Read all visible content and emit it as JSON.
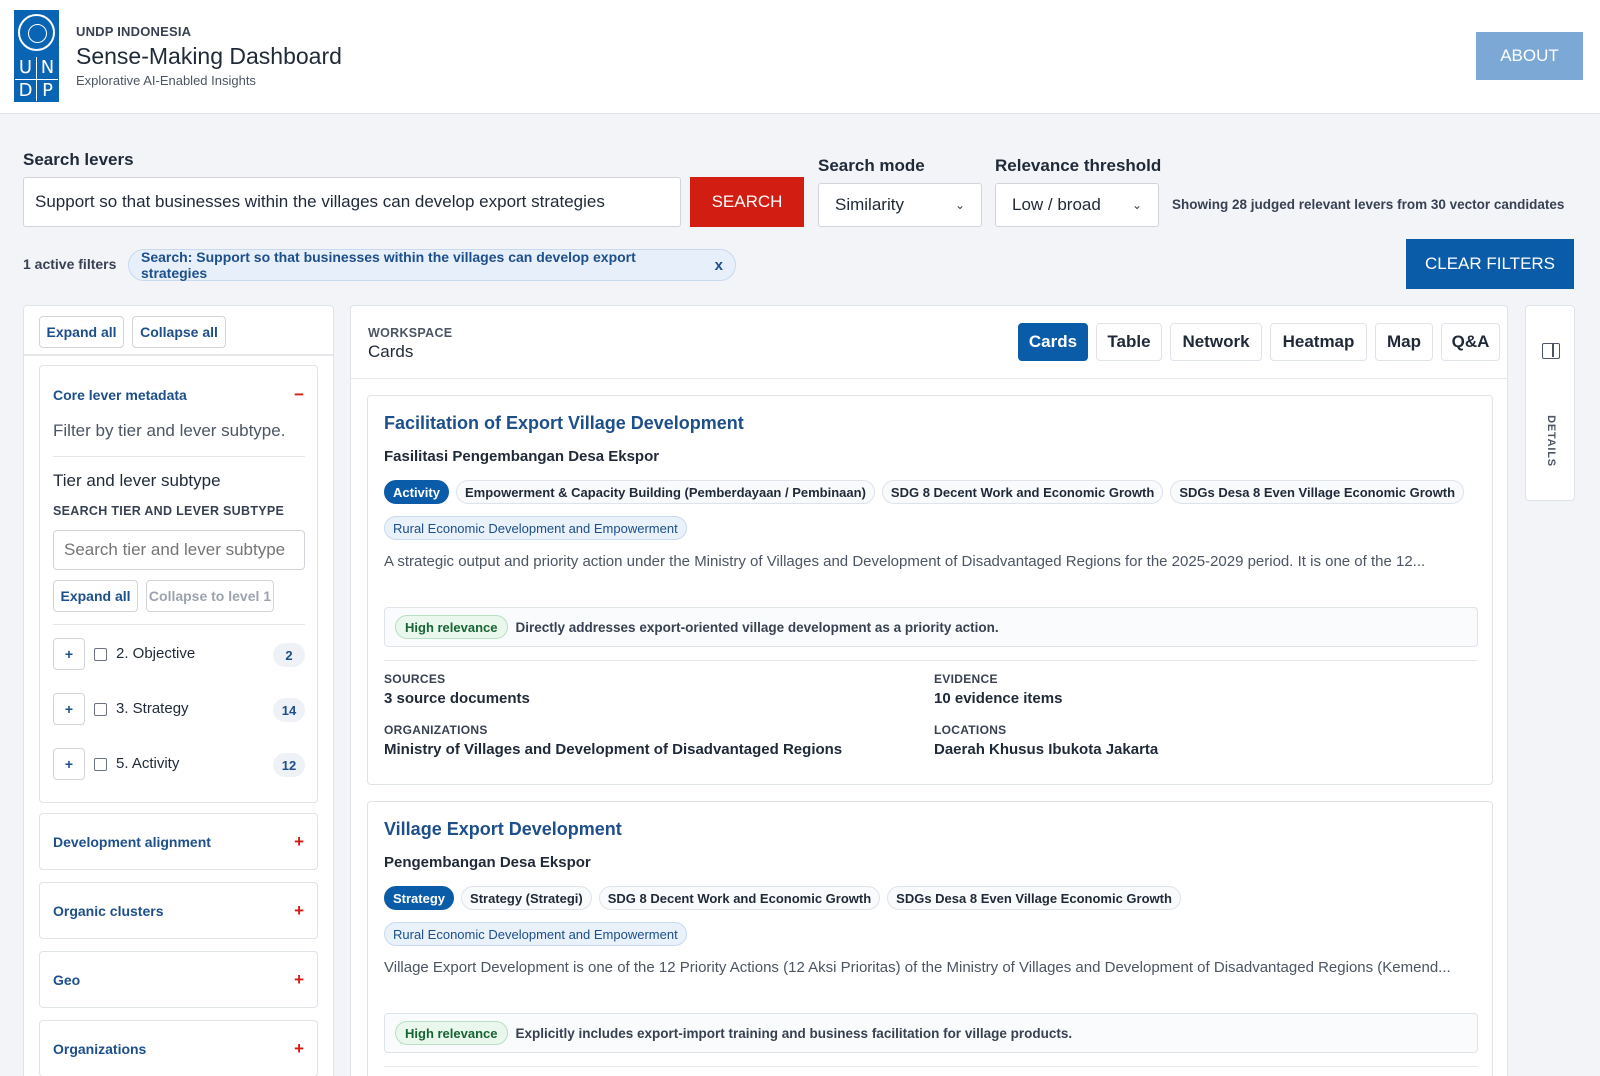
{
  "header": {
    "org": "UNDP INDONESIA",
    "title": "Sense-Making Dashboard",
    "subtitle": "Explorative AI-Enabled Insights",
    "logo_letters": [
      "U",
      "N",
      "D",
      "P"
    ],
    "about_label": "ABOUT"
  },
  "search": {
    "label": "Search levers",
    "value": "Support so that businesses within the villages can develop export strategies",
    "button_label": "SEARCH",
    "mode_label": "Search mode",
    "mode_value": "Similarity",
    "threshold_label": "Relevance threshold",
    "threshold_value": "Low / broad",
    "status": "Showing 28 judged relevant levers from 30 vector candidates"
  },
  "filters": {
    "count_text": "1 active filters",
    "chips": [
      {
        "label": "Search: Support so that businesses within the villages can develop export strategies",
        "close": "x"
      }
    ],
    "clear_label": "CLEAR FILTERS"
  },
  "sidebar": {
    "expand_all": "Expand all",
    "collapse_all": "Collapse all",
    "core": {
      "title": "Core lever metadata",
      "sign": "−",
      "description": "Filter by tier and lever subtype.",
      "subtitle": "Tier and lever subtype",
      "search_caption": "SEARCH TIER AND LEVER SUBTYPE",
      "search_placeholder": "Search tier and lever subtype",
      "expand_all": "Expand all",
      "collapse_level": "Collapse to level 1",
      "items": [
        {
          "label": "2. Objective",
          "count": "2"
        },
        {
          "label": "3. Strategy",
          "count": "14"
        },
        {
          "label": "5. Activity",
          "count": "12"
        }
      ]
    },
    "sections": [
      {
        "title": "Development alignment",
        "sign": "+"
      },
      {
        "title": "Organic clusters",
        "sign": "+"
      },
      {
        "title": "Geo",
        "sign": "+"
      },
      {
        "title": "Organizations",
        "sign": "+"
      }
    ]
  },
  "workspace": {
    "caption": "WORKSPACE",
    "title": "Cards",
    "tabs": [
      "Cards",
      "Table",
      "Network",
      "Heatmap",
      "Map",
      "Q&A"
    ],
    "active_tab": "Cards"
  },
  "cards": [
    {
      "title": "Facilitation of Export Village Development",
      "subtitle": "Fasilitasi Pengembangan Desa Ekspor",
      "tags": [
        "Activity",
        "Empowerment & Capacity Building (Pemberdayaan / Pembinaan)",
        "SDG 8 Decent Work and Economic Growth",
        "SDGs Desa 8 Even Village Economic Growth"
      ],
      "cluster": "Rural Economic Development and Empowerment",
      "description": "A strategic output and priority action under the Ministry of Villages and Development of Disadvantaged Regions for the 2025-2029 period. It is one of the 12...",
      "relevance_badge": "High relevance",
      "relevance_text": "Directly addresses export-oriented village development as a priority action.",
      "sources_label": "SOURCES",
      "sources": "3 source documents",
      "evidence_label": "EVIDENCE",
      "evidence": "10 evidence items",
      "organizations_label": "ORGANIZATIONS",
      "organizations": "Ministry of Villages and Development of Disadvantaged Regions",
      "locations_label": "LOCATIONS",
      "locations": "Daerah Khusus Ibukota Jakarta"
    },
    {
      "title": "Village Export Development",
      "subtitle": "Pengembangan Desa Ekspor",
      "tags": [
        "Strategy",
        "Strategy (Strategi)",
        "SDG 8 Decent Work and Economic Growth",
        "SDGs Desa 8 Even Village Economic Growth"
      ],
      "cluster": "Rural Economic Development and Empowerment",
      "description": "Village Export Development is one of the 12 Priority Actions (12 Aksi Prioritas) of the Ministry of Villages and Development of Disadvantaged Regions (Kemend...",
      "relevance_badge": "High relevance",
      "relevance_text": "Explicitly includes export-import training and business facilitation for village products."
    }
  ],
  "details_rail": {
    "label": "DETAILS"
  },
  "colors": {
    "brand": "#0a64b4",
    "primary": "#0a5ba8",
    "search": "#d21d12",
    "about": "#7ca8d6"
  },
  "icons": [
    "undp-logo",
    "chevron-down-icon",
    "close-icon",
    "plus-icon",
    "minus-icon",
    "checkbox-icon",
    "panel-toggle-icon"
  ]
}
